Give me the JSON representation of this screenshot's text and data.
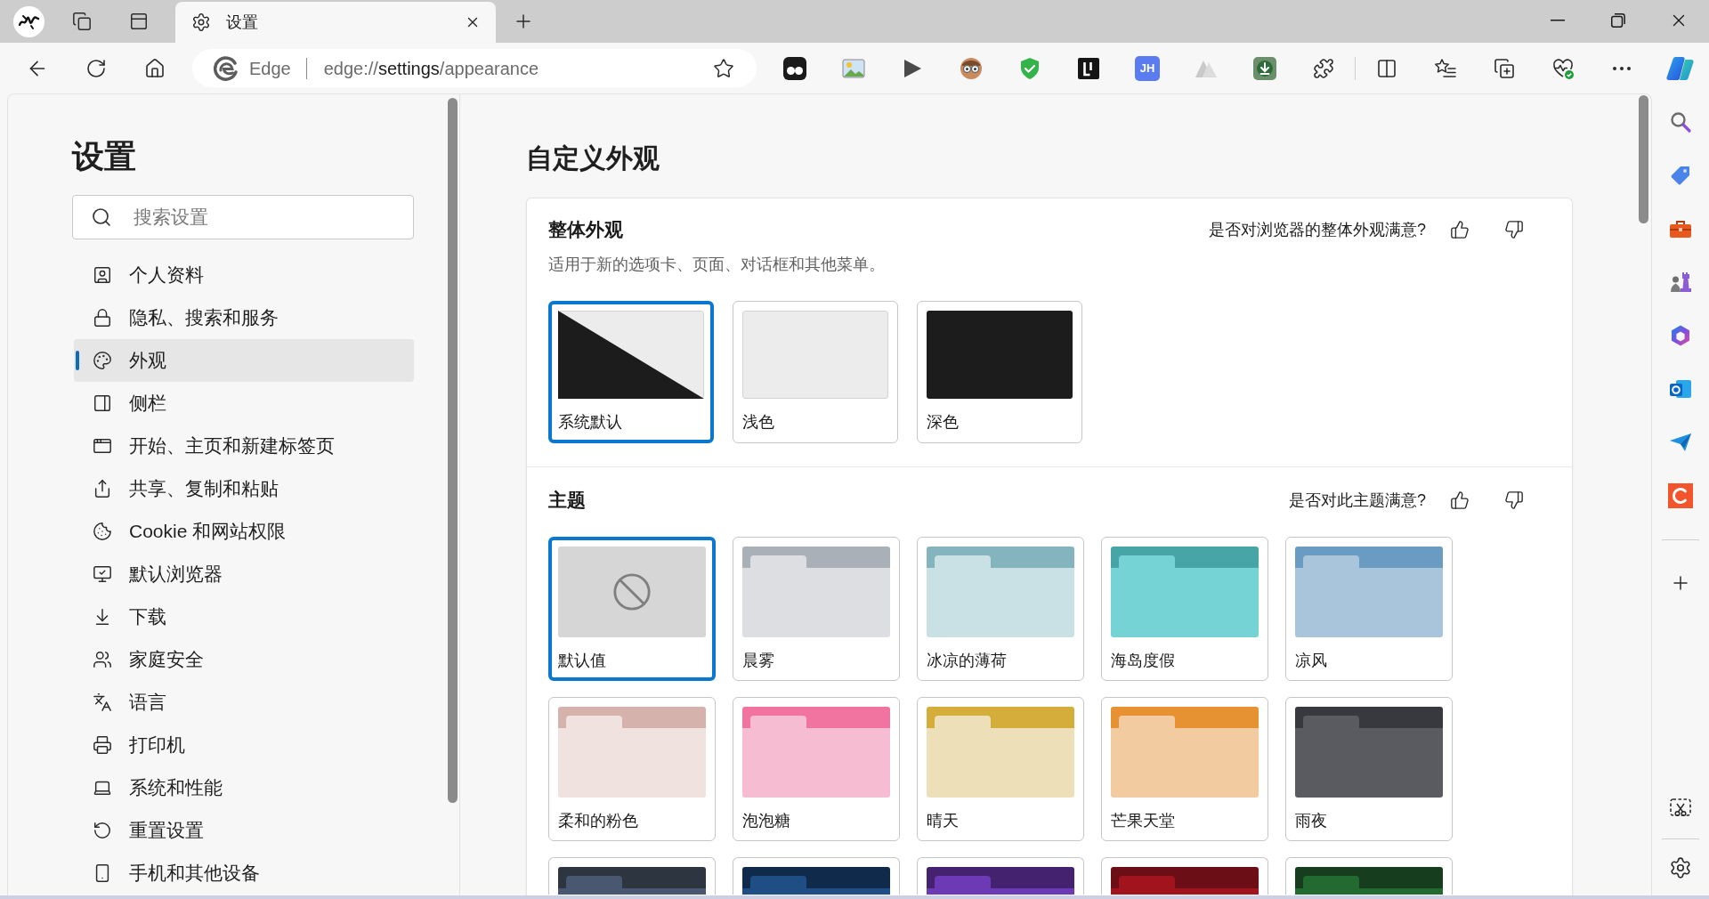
{
  "browser": {
    "tabs": [
      {
        "title": "设置",
        "selected": true
      }
    ],
    "address_bar": {
      "site_label": "Edge",
      "url": {
        "scheme": "edge://",
        "host": "settings",
        "path": "/appearance"
      }
    },
    "extension_badge": "JH"
  },
  "settings_nav": {
    "title": "设置",
    "search": {
      "placeholder": "搜索设置"
    },
    "items": [
      {
        "label": "个人资料",
        "selected": false
      },
      {
        "label": "隐私、搜索和服务",
        "selected": false
      },
      {
        "label": "外观",
        "selected": true
      },
      {
        "label": "侧栏",
        "selected": false
      },
      {
        "label": "开始、主页和新建标签页",
        "selected": false
      },
      {
        "label": "共享、复制和粘贴",
        "selected": false
      },
      {
        "label": "Cookie 和网站权限",
        "selected": false
      },
      {
        "label": "默认浏览器",
        "selected": false
      },
      {
        "label": "下载",
        "selected": false
      },
      {
        "label": "家庭安全",
        "selected": false
      },
      {
        "label": "语言",
        "selected": false
      },
      {
        "label": "打印机",
        "selected": false
      },
      {
        "label": "系统和性能",
        "selected": false
      },
      {
        "label": "重置设置",
        "selected": false
      },
      {
        "label": "手机和其他设备",
        "selected": false
      }
    ]
  },
  "main": {
    "title": "自定义外观",
    "overall_appearance": {
      "title": "整体外观",
      "description": "适用于新的选项卡、页面、对话框和其他菜单。",
      "feedback_question": "是否对浏览器的整体外观满意?",
      "options": [
        {
          "label": "系统默认",
          "kind": "system",
          "selected": true
        },
        {
          "label": "浅色",
          "kind": "light",
          "selected": false
        },
        {
          "label": "深色",
          "kind": "dark",
          "selected": false
        }
      ]
    },
    "theme": {
      "title": "主题",
      "feedback_question": "是否对此主题满意?",
      "themes": [
        {
          "label": "默认值",
          "kind": "none",
          "selected": true
        },
        {
          "label": "晨雾",
          "kind": "color",
          "selected": false,
          "header": {
            "color": "#a9b0b8"
          },
          "body": {
            "color": "#dcdee1"
          }
        },
        {
          "label": "冰凉的薄荷",
          "kind": "color",
          "selected": false,
          "header": {
            "color": "#84b5bf"
          },
          "body": {
            "color": "#c9e0e4"
          }
        },
        {
          "label": "海岛度假",
          "kind": "color",
          "selected": false,
          "header": {
            "color": "#47a5a8"
          },
          "body": {
            "color": "#75d3d5"
          }
        },
        {
          "label": "凉风",
          "kind": "color",
          "selected": false,
          "header": {
            "color": "#6a9bc3"
          },
          "body": {
            "color": "#a8c5dc"
          }
        },
        {
          "label": "柔和的粉色",
          "kind": "color",
          "selected": false,
          "header": {
            "color": "#d5b2ab"
          },
          "body": {
            "color": "#f0e2df"
          }
        },
        {
          "label": "泡泡糖",
          "kind": "color",
          "selected": false,
          "header": {
            "color": "#f174a0"
          },
          "body": {
            "color": "#f6bcd2"
          }
        },
        {
          "label": "晴天",
          "kind": "color",
          "selected": false,
          "header": {
            "color": "#d4ad3a"
          },
          "body": {
            "color": "#ede0b8"
          }
        },
        {
          "label": "芒果天堂",
          "kind": "color",
          "selected": false,
          "header": {
            "color": "#e69233"
          },
          "body": {
            "color": "#f2cba0"
          }
        },
        {
          "label": "雨夜",
          "kind": "color",
          "selected": false,
          "header": {
            "color": "#38393e"
          },
          "body": {
            "color": "#5a5b60"
          }
        },
        {
          "kind": "color",
          "selected": false,
          "header": {
            "color": "#2d3541"
          },
          "body": {
            "color": "#4a5771"
          }
        },
        {
          "kind": "color",
          "selected": false,
          "header": {
            "color": "#0f2a4b"
          },
          "body": {
            "color": "#1f4e85"
          }
        },
        {
          "kind": "color",
          "selected": false,
          "header": {
            "color": "#45226f"
          },
          "body": {
            "color": "#6c3ab4"
          }
        },
        {
          "kind": "color",
          "selected": false,
          "header": {
            "color": "#6b0e16"
          },
          "body": {
            "color": "#a1141e"
          }
        },
        {
          "kind": "color",
          "selected": false,
          "header": {
            "color": "#163d1e"
          },
          "body": {
            "color": "#236a30"
          }
        }
      ]
    }
  }
}
